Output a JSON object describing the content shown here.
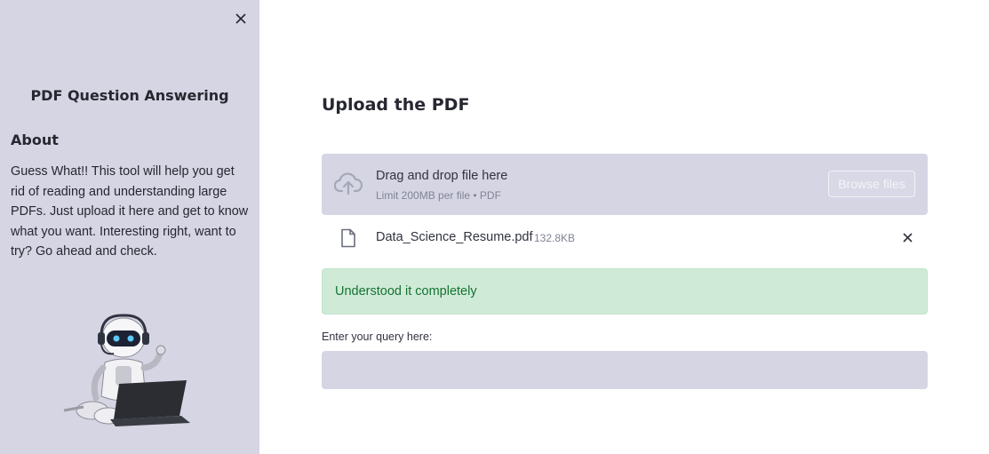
{
  "sidebar": {
    "title": "PDF Question Answering",
    "about_heading": "About",
    "about_text": "Guess What!! This tool will help you get rid of reading and understanding large PDFs. Just upload it here and get to know what you want. Interesting right, want to try? Go ahead and check."
  },
  "main": {
    "title": "Upload the PDF",
    "uploader": {
      "drag_text": "Drag and drop file here",
      "limit_text": "Limit 200MB per file • PDF",
      "browse_label": "Browse files"
    },
    "uploaded_file": {
      "name": "Data_Science_Resume.pdf",
      "size": "132.8KB"
    },
    "success_message": "Understood it completely",
    "query": {
      "label": "Enter your query here:",
      "value": ""
    }
  },
  "colors": {
    "sidebar_bg": "#d6d5e4",
    "success_bg": "#cfebd7",
    "success_text": "#177233"
  }
}
